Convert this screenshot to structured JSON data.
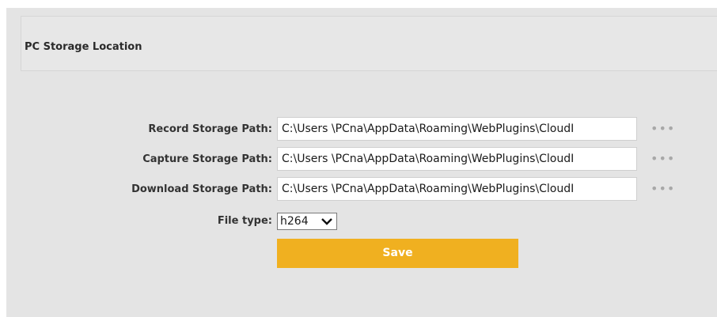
{
  "section": {
    "title": "PC Storage Location"
  },
  "fields": [
    {
      "label": "Record Storage Path:",
      "value": "C:\\Users \\PCna\\AppData\\Roaming\\WebPlugins\\CloudI"
    },
    {
      "label": "Capture Storage Path:",
      "value": "C:\\Users \\PCna\\AppData\\Roaming\\WebPlugins\\CloudI"
    },
    {
      "label": "Download Storage Path:",
      "value": "C:\\Users \\PCna\\AppData\\Roaming\\WebPlugins\\CloudI"
    }
  ],
  "browse_label": "•••",
  "file_type": {
    "label": "File type:",
    "value": "h264"
  },
  "save_label": "Save",
  "colors": {
    "accent": "#f0b020",
    "panel": "#e4e4e4"
  }
}
